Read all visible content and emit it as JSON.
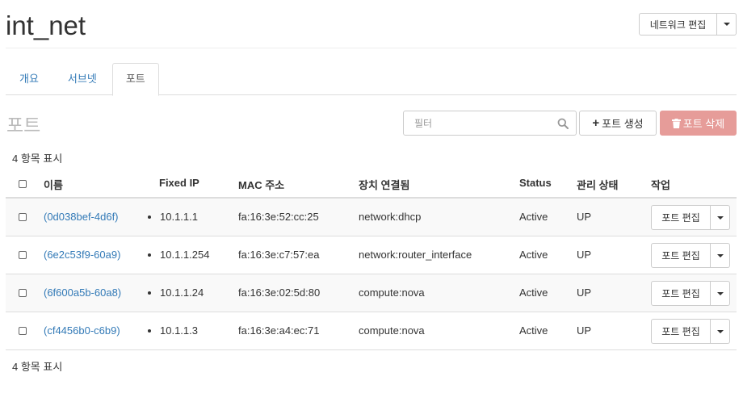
{
  "header": {
    "title": "int_net",
    "edit_button": "네트워크 편집"
  },
  "tabs": [
    {
      "label": "개요",
      "active": false
    },
    {
      "label": "서브넷",
      "active": false
    },
    {
      "label": "포트",
      "active": true
    }
  ],
  "section": {
    "title": "포트",
    "filter_placeholder": "필터",
    "create_button": "포트 생성",
    "delete_button": "포트 삭제",
    "count_label": "4 항목 표시"
  },
  "table": {
    "columns": [
      "이름",
      "Fixed IP",
      "MAC 주소",
      "장치 연결됨",
      "Status",
      "관리 상태",
      "작업"
    ],
    "rows": [
      {
        "name": "(0d038bef-4d6f)",
        "fixed_ip": "10.1.1.1",
        "mac": "fa:16:3e:52:cc:25",
        "device": "network:dhcp",
        "status": "Active",
        "admin_state": "UP",
        "action": "포트 편집"
      },
      {
        "name": "(6e2c53f9-60a9)",
        "fixed_ip": "10.1.1.254",
        "mac": "fa:16:3e:c7:57:ea",
        "device": "network:router_interface",
        "status": "Active",
        "admin_state": "UP",
        "action": "포트 편집"
      },
      {
        "name": "(6f600a5b-60a8)",
        "fixed_ip": "10.1.1.24",
        "mac": "fa:16:3e:02:5d:80",
        "device": "compute:nova",
        "status": "Active",
        "admin_state": "UP",
        "action": "포트 편집"
      },
      {
        "name": "(cf4456b0-c6b9)",
        "fixed_ip": "10.1.1.3",
        "mac": "fa:16:3e:a4:ec:71",
        "device": "compute:nova",
        "status": "Active",
        "admin_state": "UP",
        "action": "포트 편집"
      }
    ]
  },
  "colors": {
    "link": "#337ab7",
    "danger_button": "#e69c99",
    "muted_title": "#bbbbbb"
  },
  "icons": [
    "caret-down-icon",
    "search-icon",
    "plus-icon",
    "trash-icon"
  ]
}
